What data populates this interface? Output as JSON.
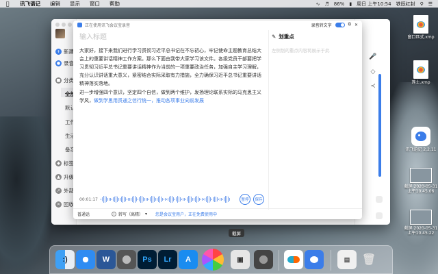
{
  "menubar": {
    "apple_icon": "apple-icon",
    "app_name": "讯飞语记",
    "menus": [
      "编辑",
      "显示",
      "窗口",
      "帮助"
    ],
    "battery": "86%",
    "datetime": "周日 上午10:54",
    "user": "铁既红封"
  },
  "sidebar": {
    "new_label": "新建",
    "record_label": "录音",
    "category_label": "分类",
    "sub_items": [
      "全部",
      "默认",
      "工作",
      "生活",
      "备忘"
    ],
    "tags_label": "标签",
    "upgrade_label": "升级",
    "external_label": "外部",
    "recycle_label": "回收"
  },
  "dialog": {
    "header_text": "正在使用讯飞会议宝录音",
    "transcribe_label": "录音转文字",
    "title_placeholder": "输入标题",
    "paragraph1": "大家好，接下来我们进行学习贯彻习近平总书记在不忘初心，牢记使命主题教育总结大会上的重要讲话精神工作方案。那么下面由我带大家学习该文件。各级党员干部要把学习贯彻习近平总书记重要讲话精神作为当前的一项重要政治任务，加强自主学习理解，充分认识讲话重大意义，紧密结合实际采取有力措施，全力确保习近平总书记重要讲话精神落实落地。",
    "paragraph2_plain": "进一步增强四个意识，坚定四个自信，做到两个维护，发扬理论联系实际的马克思主义学风，",
    "paragraph2_highlight": "做到学思用贯通之信行统一，推动各项事业向前发展",
    "notes_title": "划重点",
    "notes_placeholder": "左侧划的重点内容将展示于此",
    "time": "00:01:17",
    "pause_label": "暂停",
    "save_label": "保存",
    "mode_label": "普通话",
    "transcribe_mode": "转写（高精）",
    "bottom_link": "您是会议宝用户，正在免费使用中"
  },
  "desktop_icons": [
    {
      "label": "窗口匹式.xmp"
    },
    {
      "label": "莲士.xmp"
    },
    {
      "label": "讯飞语记 2.2.11"
    },
    {
      "label": "截屏 2020-05-31 上午10.45.06"
    },
    {
      "label": "截屏 2020-05-31 上午10.45.22"
    }
  ],
  "tooltip": "截屏",
  "dock_apps": [
    "Finder",
    "Safari",
    "Word",
    "Launchpad",
    "Photoshop",
    "Lightroom",
    "App Store",
    "Photos",
    "Screenshot",
    "System Preferences",
    "Baidu Netdisk",
    "讯飞语记",
    "Documents",
    "Trash"
  ],
  "colors": {
    "accent": "#3b7de9"
  }
}
